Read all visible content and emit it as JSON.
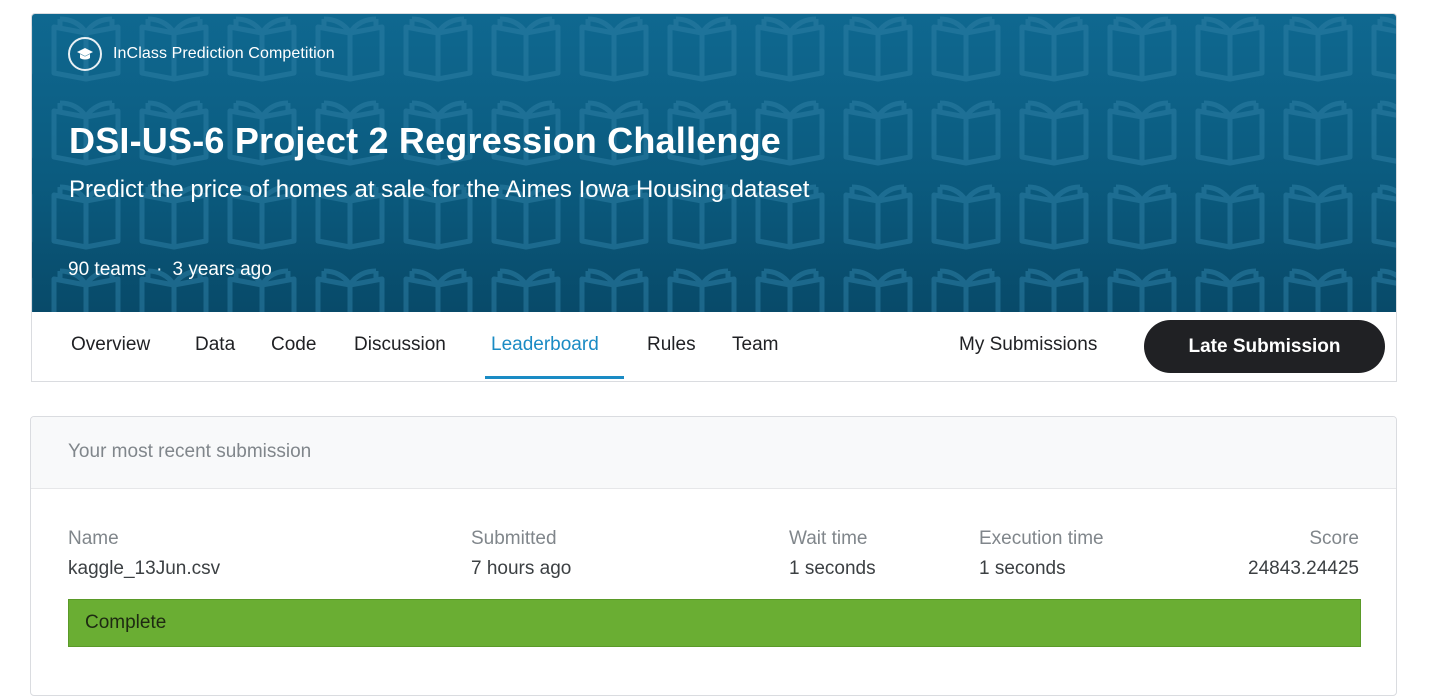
{
  "competition": {
    "badge_label": "InClass Prediction Competition",
    "title": "DSI-US-6 Project 2 Regression Challenge",
    "subtitle": "Predict the price of homes at sale for the Aimes Iowa Housing dataset",
    "teams": "90 teams",
    "separator": "·",
    "age": "3 years ago",
    "icons": {
      "badge": "graduation-cap-icon",
      "pattern": "open-book-icon"
    },
    "colors": {
      "banner": "#0b5b7f",
      "accent": "#1a8bc4"
    }
  },
  "nav": {
    "tabs": [
      {
        "label": "Overview"
      },
      {
        "label": "Data"
      },
      {
        "label": "Code"
      },
      {
        "label": "Discussion"
      },
      {
        "label": "Leaderboard",
        "active": true
      },
      {
        "label": "Rules"
      },
      {
        "label": "Team"
      }
    ],
    "my_submissions": "My Submissions",
    "late_submission": "Late Submission"
  },
  "submission": {
    "header": "Your most recent submission",
    "columns": {
      "name": {
        "label": "Name",
        "value": "kaggle_13Jun.csv"
      },
      "submitted": {
        "label": "Submitted",
        "value": "7 hours ago"
      },
      "wait": {
        "label": "Wait time",
        "value": "1 seconds"
      },
      "execution": {
        "label": "Execution time",
        "value": "1 seconds"
      },
      "score": {
        "label": "Score",
        "value": "24843.24425"
      }
    },
    "status": "Complete",
    "status_color": "#6aae33"
  }
}
